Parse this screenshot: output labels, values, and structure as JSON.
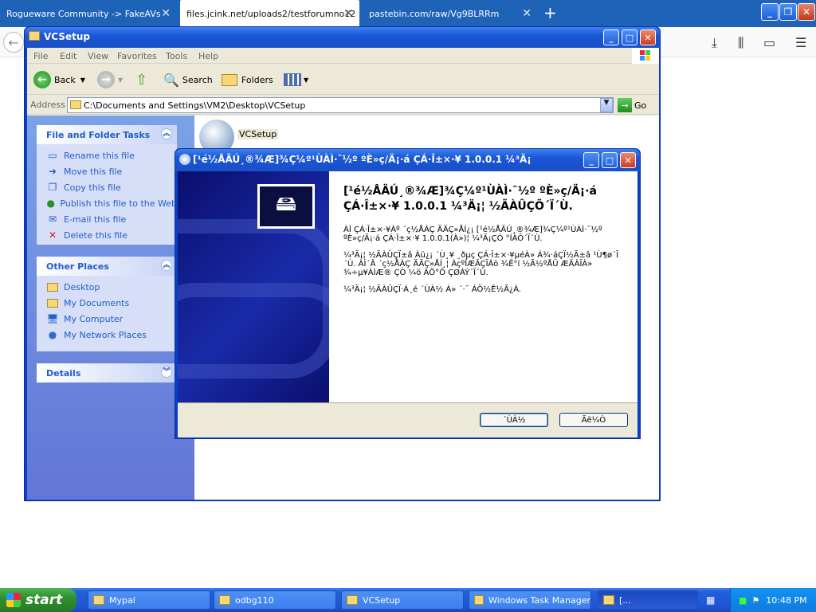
{
  "browser": {
    "tabs": [
      {
        "title": "Rogueware Community -> FakeAVs"
      },
      {
        "title": "files.jcink.net/uploads2/testforumno12"
      },
      {
        "title": "pastebin.com/raw/Vg9BLRRm"
      }
    ],
    "new_tab": "+",
    "close": "✕"
  },
  "explorer": {
    "title": "VCSetup",
    "menu": [
      "File",
      "Edit",
      "View",
      "Favorites",
      "Tools",
      "Help"
    ],
    "toolbar": {
      "back": "Back",
      "search": "Search",
      "folders": "Folders"
    },
    "address_label": "Address",
    "address": "C:\\Documents and Settings\\VM2\\Desktop\\VCSetup",
    "go": "Go",
    "file_tasks": {
      "title": "File and Folder Tasks",
      "items": [
        "Rename this file",
        "Move this file",
        "Copy this file",
        "Publish this file to the Web",
        "E-mail this file",
        "Delete this file"
      ]
    },
    "other_places": {
      "title": "Other Places",
      "items": [
        "Desktop",
        "My Documents",
        "My Computer",
        "My Network Places"
      ]
    },
    "details": {
      "title": "Details"
    },
    "file": {
      "name": "VCSetup"
    }
  },
  "setup": {
    "title": "[¹é½ÅÄÚ¸®¾Æ]¾Ç¼º¹ÙÀÌ·¯½º ºÈ»ç/Ä¡·á ÇÁ·Î±×·¥ 1.0.0.1 ¼³Ä¡",
    "heading": "[¹é½ÅÄÚ¸®¾Æ]¾Ç¼º¹ÙÀÌ·¯½º ºÈ»ç/Ä¡·á ÇÁ·Î±×·¥ 1.0.0.1 ¼³Ä¡¦ ½ÃÀÛÇÕ´Ï´Ù.",
    "paragraphs": [
      "ÀÌ ÇÁ·Î±×·¥Àº ´ç½ÅÀÇ ÄÄÇ»ÅÍ¿¡ [¹é½ÅÄÚ¸®¾Æ]¾Ç¼º¹ÙÀÌ·¯½º ºÈ»ç/Ä¡·á ÇÁ·Î±×·¥ 1.0.0.1(À»)¦ ¼³Ä¡ÇÒ °ÍÀÔ´Ï´Ù.",
      "¼³Ä¡¦ ½ÃÀÛÇÏ±â Àü¿¡ ´Ù¸¥ ¸ðµç ÇÁ·Î±×·¥µéÀ» Á¾·áÇÏ½Ã±â ¹Ù¶ø´Ï´Ù. ÀÌ´Â ´ç½ÅÀÇ ÄÄÇ»ÅÍ¸¦ ÀçºÎÆÃÇÏÁö ¾Ê°í ½Ã½ºÅÛ ÆÄÀÏÀ» ¾÷µ¥ÀÌÆ® ÇÒ ¼ö ÀÖ°Ô ÇØÁÝ´Ï´Ù.",
      "¼³Ä¡¦ ½ÃÀÛÇÏ·Á¸é ´ÙÀ½ À» ´­·¯ ÁÖ½Ê½Ã¿À."
    ],
    "next_button": "´ÙÀ½",
    "cancel_button": "Ãë¼Ò"
  },
  "taskbar": {
    "start": "start",
    "tasks": [
      {
        "label": "Mypal"
      },
      {
        "label": "odbg110"
      },
      {
        "label": "VCSetup"
      },
      {
        "label": "Windows Task Manager"
      },
      {
        "label": "[..."
      }
    ],
    "clock": "10:48 PM"
  }
}
